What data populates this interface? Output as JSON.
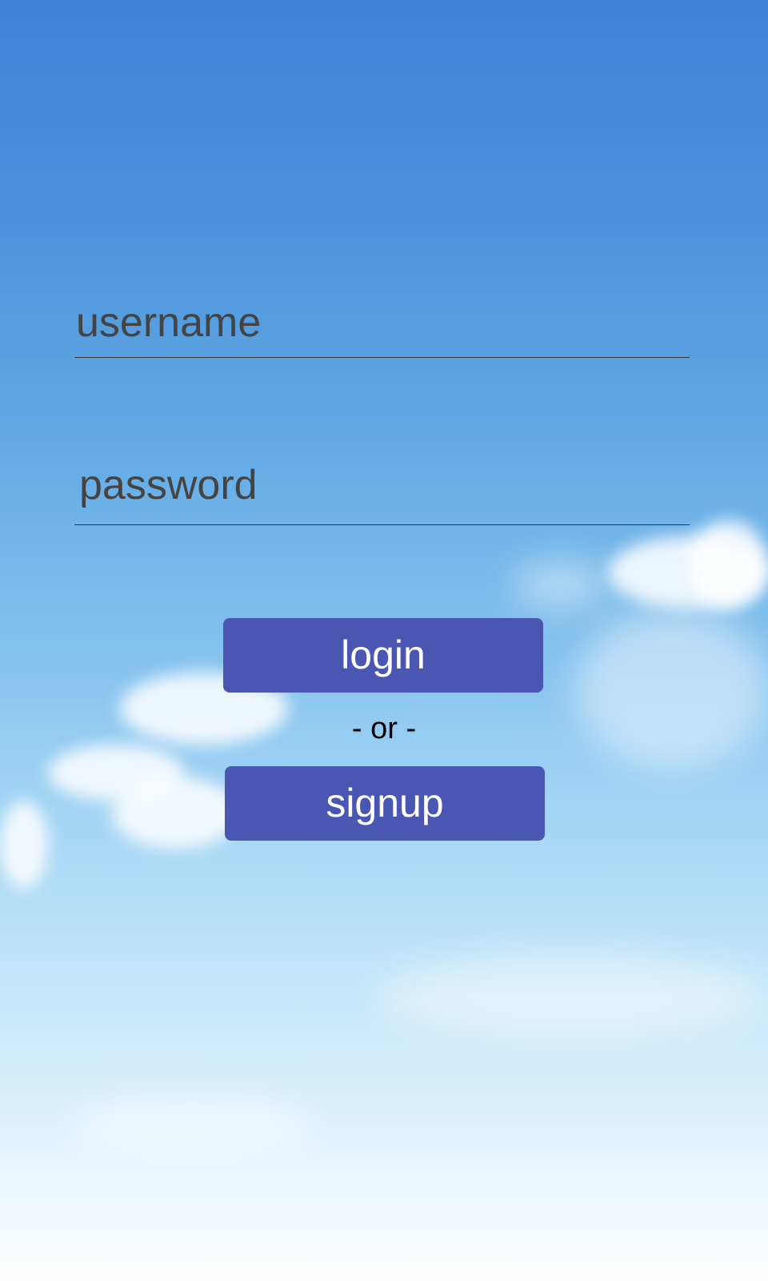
{
  "form": {
    "username_placeholder": "username",
    "password_placeholder": "password",
    "login_label": "login",
    "or_text": "- or -",
    "signup_label": "signup"
  },
  "colors": {
    "button_bg": "#4a57b2",
    "button_text": "#ffffff",
    "field_text": "#444444",
    "sky_top": "#3d82d4",
    "sky_bottom": "#ffffff"
  }
}
